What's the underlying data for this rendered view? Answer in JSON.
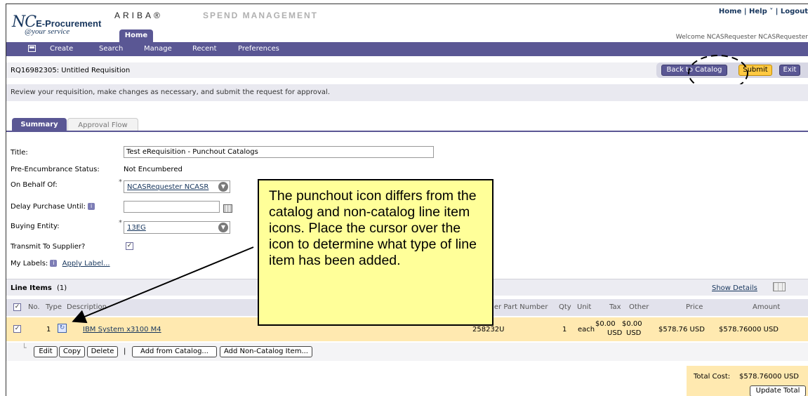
{
  "header": {
    "logo_nc": "NC",
    "logo_ep": "E-Procurement",
    "logo_tagline": "@your service",
    "ariba": "ARIBA®",
    "spend": "SPEND MANAGEMENT",
    "home_tab": "Home",
    "home_link": "Home",
    "help_link": "Help ˅",
    "logout_link": "Logout",
    "welcome": "Welcome NCASRequester NCASRequester"
  },
  "nav": {
    "items": [
      "Create",
      "Search",
      "Manage",
      "Recent",
      "Preferences"
    ]
  },
  "requisition": {
    "title": "RQ16982305: Untitled Requisition",
    "buttons": {
      "back": "Back to Catalog",
      "submit": "Submit",
      "exit": "Exit"
    },
    "review_message": "Review your requisition, make changes as necessary, and submit the request for approval."
  },
  "tabs": {
    "summary": "Summary",
    "approval": "Approval Flow"
  },
  "form": {
    "title_label": "Title:",
    "title_value": "Test eRequisition - Punchout Catalogs",
    "status_label": "Pre-Encumbrance Status:",
    "status_value": "Not Encumbered",
    "behalf_label": "On Behalf Of:",
    "behalf_value": "NCASRequester NCASR",
    "delay_label": "Delay Purchase Until:",
    "entity_label": "Buying Entity:",
    "entity_value": "13EG",
    "transmit_label": "Transmit To Supplier?",
    "labels_label": "My Labels:",
    "apply_label": "Apply Label...",
    "required": "*"
  },
  "line_items": {
    "header_label": "Line Items",
    "count": "(1)",
    "show_details": "Show Details",
    "columns": {
      "no": "No.",
      "type": "Type",
      "description": "Description",
      "supplier_part": "plier Part Number",
      "qty": "Qty",
      "unit": "Unit",
      "tax": "Tax",
      "other": "Other",
      "price": "Price",
      "amount": "Amount"
    },
    "rows": [
      {
        "no": "1",
        "description": "IBM System x3100 M4",
        "supplier_part": "258232U",
        "qty": "1",
        "unit": "each",
        "tax": "$0.00",
        "tax_cur": "USD",
        "other": "$0.00",
        "other_cur": "USD",
        "price": "$578.76 USD",
        "amount": "$578.76000 USD"
      }
    ],
    "actions": [
      "Edit",
      "Copy",
      "Delete",
      "Add from Catalog...",
      "Add Non-Catalog Item..."
    ],
    "separator": "|"
  },
  "totals": {
    "label": "Total Cost:",
    "value": "$578.76000 USD",
    "update_button": "Update Total"
  },
  "callout": {
    "text": "The punchout icon differs from the catalog and non-catalog line item icons. Place the cursor over the icon to determine what type of line item has been added."
  },
  "colors": {
    "nav_purple": "#5a5794",
    "callout_yellow": "#ffff99",
    "row_highlight": "#ffe9b0",
    "submit_yellow": "#ffc942"
  }
}
